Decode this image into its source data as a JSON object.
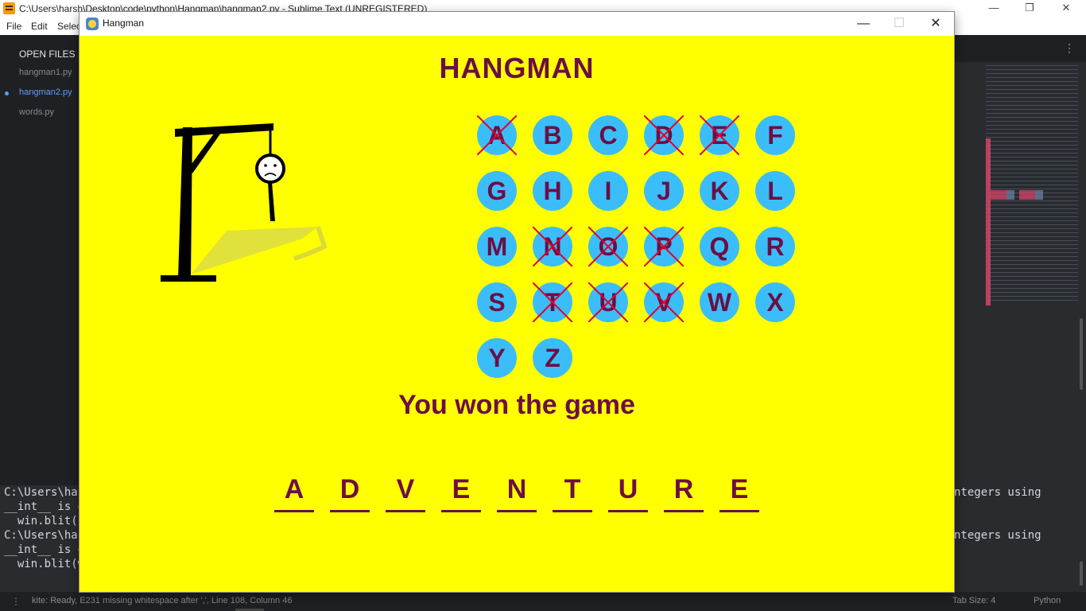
{
  "sublime": {
    "title": "C:\\Users\\harsh\\Desktop\\code\\python\\Hangman\\hangman2.py - Sublime Text (UNREGISTERED)",
    "menu": [
      "File",
      "Edit",
      "Selec"
    ],
    "sidebar_heading": "OPEN FILES",
    "files": [
      "hangman1.py",
      "hangman2.py",
      "words.py"
    ],
    "active_file": "hangman2.py",
    "console_left": [
      "C:\\Users\\har",
      "__int__ is d",
      "  win.blit(i",
      "C:\\Users\\har",
      "__int__ is d",
      "  win.blit(w"
    ],
    "console_right": [
      "ntegers using",
      "ntegers using"
    ],
    "status_left": "kite: Ready, E231 missing whitespace after ',', Line 108, Column 46",
    "status_tab": "Tab Size: 4",
    "status_lang": "Python",
    "window_minimize": "—",
    "window_restore": "❐",
    "window_close": "✕"
  },
  "hangman": {
    "window_title": "Hangman",
    "minimize": "—",
    "maximize": "☐",
    "close": "✕",
    "heading": "HANGMAN",
    "letters": [
      {
        "char": "A",
        "used": true
      },
      {
        "char": "B",
        "used": false
      },
      {
        "char": "C",
        "used": false
      },
      {
        "char": "D",
        "used": true
      },
      {
        "char": "E",
        "used": true
      },
      {
        "char": "F",
        "used": false
      },
      {
        "char": "G",
        "used": false
      },
      {
        "char": "H",
        "used": false
      },
      {
        "char": "I",
        "used": false
      },
      {
        "char": "J",
        "used": false
      },
      {
        "char": "K",
        "used": false
      },
      {
        "char": "L",
        "used": false
      },
      {
        "char": "M",
        "used": false
      },
      {
        "char": "N",
        "used": true
      },
      {
        "char": "O",
        "used": true
      },
      {
        "char": "P",
        "used": true
      },
      {
        "char": "Q",
        "used": false
      },
      {
        "char": "R",
        "used": false
      },
      {
        "char": "S",
        "used": false
      },
      {
        "char": "T",
        "used": true
      },
      {
        "char": "U",
        "used": true
      },
      {
        "char": "V",
        "used": true
      },
      {
        "char": "W",
        "used": false
      },
      {
        "char": "X",
        "used": false
      },
      {
        "char": "Y",
        "used": false
      },
      {
        "char": "Z",
        "used": false
      }
    ],
    "message": "You won the game",
    "word": [
      "A",
      "D",
      "V",
      "E",
      "N",
      "T",
      "U",
      "R",
      "E"
    ],
    "colors": {
      "background": "#ffff00",
      "text": "#6b0f45",
      "button": "#3bbdfa",
      "cross": "#e0002a"
    }
  }
}
